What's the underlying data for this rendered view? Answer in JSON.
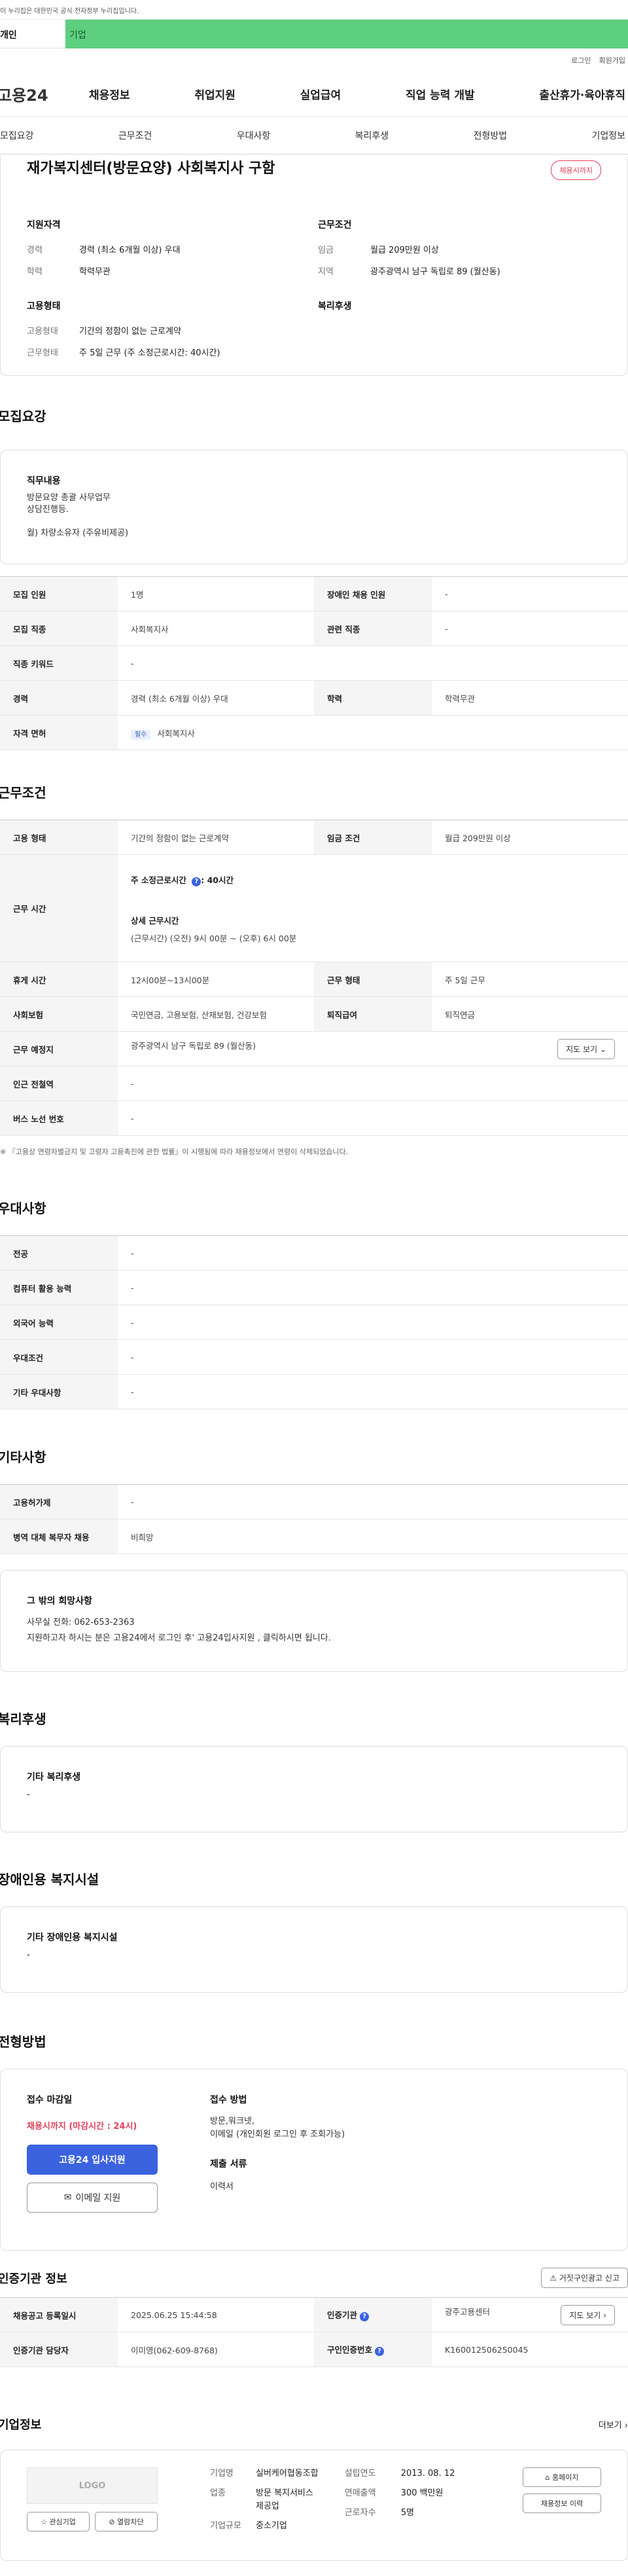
{
  "gov_banner": "이 누리집은 대한민국 공식 전자정부 누리집입니다.",
  "top_tabs": {
    "individual": "개인",
    "business": "기업"
  },
  "util": {
    "login": "로그인",
    "join": "회원가입"
  },
  "logo": "고용24",
  "gnb": [
    "채용정보",
    "취업지원",
    "실업급여",
    "직업 능력 개발",
    "출산휴가·육아휴직"
  ],
  "anchor_nav": [
    "모집요강",
    "근무조건",
    "우대사항",
    "복리후생",
    "전형방법",
    "기업정보"
  ],
  "summary": {
    "title": "재가복지센터(방문요양) 사회복지사 구함",
    "status_badge": "채용시까지",
    "qual_h": "지원자격",
    "career_k": "경력",
    "career_v": "경력 (최소 6개월 이상) 우대",
    "edu_k": "학력",
    "edu_v": "학력무관",
    "cond_h": "근무조건",
    "wage_k": "임금",
    "wage_v": "월급 209만원 이상",
    "region_k": "지역",
    "region_v": "광주광역시 남구 독립로 89 (월산동)",
    "emp_h": "고용형태",
    "emptype_k": "고용형태",
    "emptype_v": "기간의 정함이 없는 근로계약",
    "worktype_k": "근무형태",
    "worktype_v": "주 5일 근무 (주 소정근로시간: 40시간)",
    "welfare_h": "복리후생"
  },
  "recruit": {
    "heading": "모집요강",
    "duty_h": "직무내용",
    "duty_lines": [
      "방문요양 총괄 사무업무",
      "상담진행등.",
      "",
      "월) 차량소유자 (주유비제공)"
    ],
    "rows": {
      "headcount_k": "모집 인원",
      "headcount_v": "1명",
      "disabled_k": "장애인 채용 인원",
      "disabled_v": "-",
      "job_k": "모집 직종",
      "job_v": "사회복지사",
      "related_k": "관련 직종",
      "related_v": "-",
      "keyword_k": "직종 키워드",
      "keyword_v": "-",
      "career_k": "경력",
      "career_v": "경력 (최소 6개월 이상) 우대",
      "edu_k": "학력",
      "edu_v": "학력무관",
      "license_k": "자격 면허",
      "license_tag": "필수",
      "license_v": "사회복지사"
    }
  },
  "conditions": {
    "heading": "근무조건",
    "emptype_k": "고용 형태",
    "emptype_v": "기간의 정함이 없는 근로계약",
    "wage_k": "임금 조건",
    "wage_v": "월급 209만원 이상",
    "hours_k": "근무 시간",
    "hours_week_label": "주 소정근로시간",
    "hours_week_v": ": 40시간",
    "hours_detail_h": "상세 근무시간",
    "hours_detail_v": "(근무시간) (오전) 9시 00분 ~ (오후) 6시 00분",
    "break_k": "휴게 시간",
    "break_v": "12시00분~13시00분",
    "worktype_k": "근무 형태",
    "worktype_v": "주 5일 근무",
    "insurance_k": "사회보험",
    "insurance_v": "국민연금, 고용보험, 산재보험, 건강보험",
    "retire_k": "퇴직급여",
    "retire_v": "퇴직연금",
    "place_k": "근무 예정지",
    "place_v": "광주광역시 남구 독립로 89 (월산동)",
    "map_btn": "지도 보기",
    "subway_k": "인근 전철역",
    "subway_v": "-",
    "bus_k": "버스 노선 번호",
    "bus_v": "-",
    "note": "※ 『고용상 연령차별금지 및 고령자 고용촉진에 관한 법률』이 시행됨에 따라 채용정보에서 연령이 삭제되었습니다."
  },
  "preferred": {
    "heading": "우대사항",
    "rows": [
      {
        "k": "전공",
        "v": "-"
      },
      {
        "k": "컴퓨터 활용 능력",
        "v": "-"
      },
      {
        "k": "외국어 능력",
        "v": "-"
      },
      {
        "k": "우대조건",
        "v": "-"
      },
      {
        "k": "기타 우대사항",
        "v": "-"
      }
    ]
  },
  "etc": {
    "heading": "기타사항",
    "rows": [
      {
        "k": "고용허가제",
        "v": "-"
      },
      {
        "k": "병역 대체 복무자 채용",
        "v": "비희망"
      }
    ],
    "other_h": "그 밖의 희망사항",
    "other_lines": [
      "사무실 전화: 062-653-2363",
      "지원하고자 하시는 분은 고용24에서 로그인 후' 고용24입사지원 , 클릭하시면 됩니다."
    ]
  },
  "welfare": {
    "heading": "복리후생",
    "sub_h": "기타 복리후생",
    "v": "-"
  },
  "disability": {
    "heading": "장애인용 복지시설",
    "sub_h": "기타 장애인용 복지시설",
    "v": "-"
  },
  "selection": {
    "heading": "전형방법",
    "deadline_h": "접수 마감일",
    "deadline_v": "채용시까지 (마감시간 : 24시)",
    "apply_btn": "고용24 입사지원",
    "email_btn": "이메일 지원",
    "method_h": "접수 방법",
    "method_lines": [
      "방문,워크넷,",
      "이메일 (개인회원 로그인 후 조회가능)"
    ],
    "docs_h": "제출 서류",
    "docs_v": "이력서"
  },
  "agency": {
    "heading": "인증기관 정보",
    "report_btn": "거짓구인광고 신고",
    "reg_k": "채용공고 등록일시",
    "reg_v": "2025.06.25 15:44:58",
    "agency_k": "인증기관",
    "agency_v": "광주고용센터",
    "map_btn": "지도 보기",
    "manager_k": "인증기관 담당자",
    "manager_v": "이미영(062-609-8768)",
    "certno_k": "구인인증번호",
    "certno_v": "K160012506250045"
  },
  "company": {
    "heading": "기업정보",
    "more": "더보기",
    "logo_placeholder": "LOGO",
    "fav_btn": "관심기업",
    "block_btn": "열람차단",
    "name_k": "기업명",
    "name_v": "실버케어협동조합",
    "biz_k": "업종",
    "biz_v1": "방문 복지서비스",
    "biz_v2": "제공업",
    "size_k": "기업규모",
    "size_v": "중소기업",
    "founded_k": "설립연도",
    "founded_v": "2013. 08. 12",
    "sales_k": "연매출액",
    "sales_v": "300 백만원",
    "staff_k": "근로자수",
    "staff_v": "5명",
    "home_btn": "홈페이지",
    "history_btn": "채용정보 이력"
  }
}
